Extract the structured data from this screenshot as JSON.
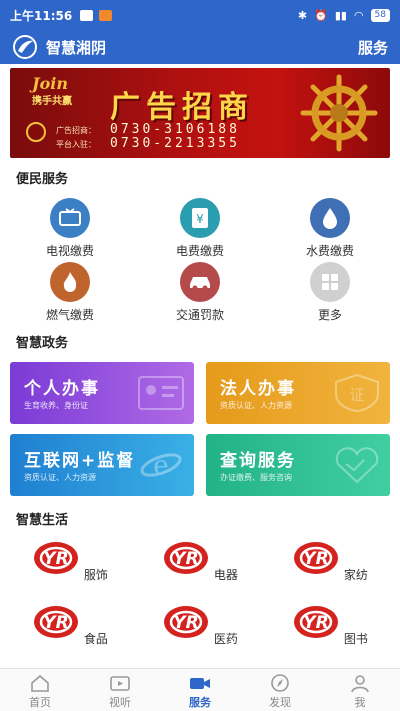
{
  "status_bar": {
    "time": "上午11:56",
    "battery": "58"
  },
  "header": {
    "app_title": "智慧湘阴",
    "page_title": "服务"
  },
  "banner": {
    "join": "Join",
    "sub": "携手共赢",
    "headline": "广告招商",
    "label1": "广告招商：",
    "phone1": "0730-3106188",
    "label2": "平台入驻：",
    "phone2": "0730-2213355"
  },
  "sections": {
    "convenience": "便民服务",
    "government": "智慧政务",
    "life": "智慧生活"
  },
  "convenience_items": [
    {
      "label": "电视缴费",
      "icon": "tv-icon",
      "color": "#3b7fc4"
    },
    {
      "label": "电费缴费",
      "icon": "electric-bill-icon",
      "color": "#2a9db0"
    },
    {
      "label": "水费缴费",
      "icon": "water-drop-icon",
      "color": "#3f6fb5"
    },
    {
      "label": "燃气缴费",
      "icon": "flame-icon",
      "color": "#c0642e"
    },
    {
      "label": "交通罚款",
      "icon": "car-icon",
      "color": "#b54a4a"
    },
    {
      "label": "更多",
      "icon": "more-grid-icon",
      "color": "#d0d0d0"
    }
  ],
  "gov_cards": [
    {
      "title": "个人办事",
      "sub": "生育收养、身份证"
    },
    {
      "title": "法人办事",
      "sub": "资质认证、人力资源"
    },
    {
      "title": "互联网+监督",
      "sub": "资质认证、人力资源"
    },
    {
      "title": "查询服务",
      "sub": "办证缴费、服务咨询"
    }
  ],
  "life_items": [
    {
      "label": "服饰"
    },
    {
      "label": "电器"
    },
    {
      "label": "家纺"
    },
    {
      "label": "食品"
    },
    {
      "label": "医药"
    },
    {
      "label": "图书"
    }
  ],
  "nav": [
    {
      "label": "首页",
      "icon": "home-icon"
    },
    {
      "label": "视听",
      "icon": "tv-play-icon"
    },
    {
      "label": "服务",
      "icon": "video-camera-icon"
    },
    {
      "label": "发现",
      "icon": "compass-icon"
    },
    {
      "label": "我",
      "icon": "user-icon"
    }
  ],
  "colors": {
    "brand": "#2f66c9",
    "banner_red": "#b01010"
  }
}
